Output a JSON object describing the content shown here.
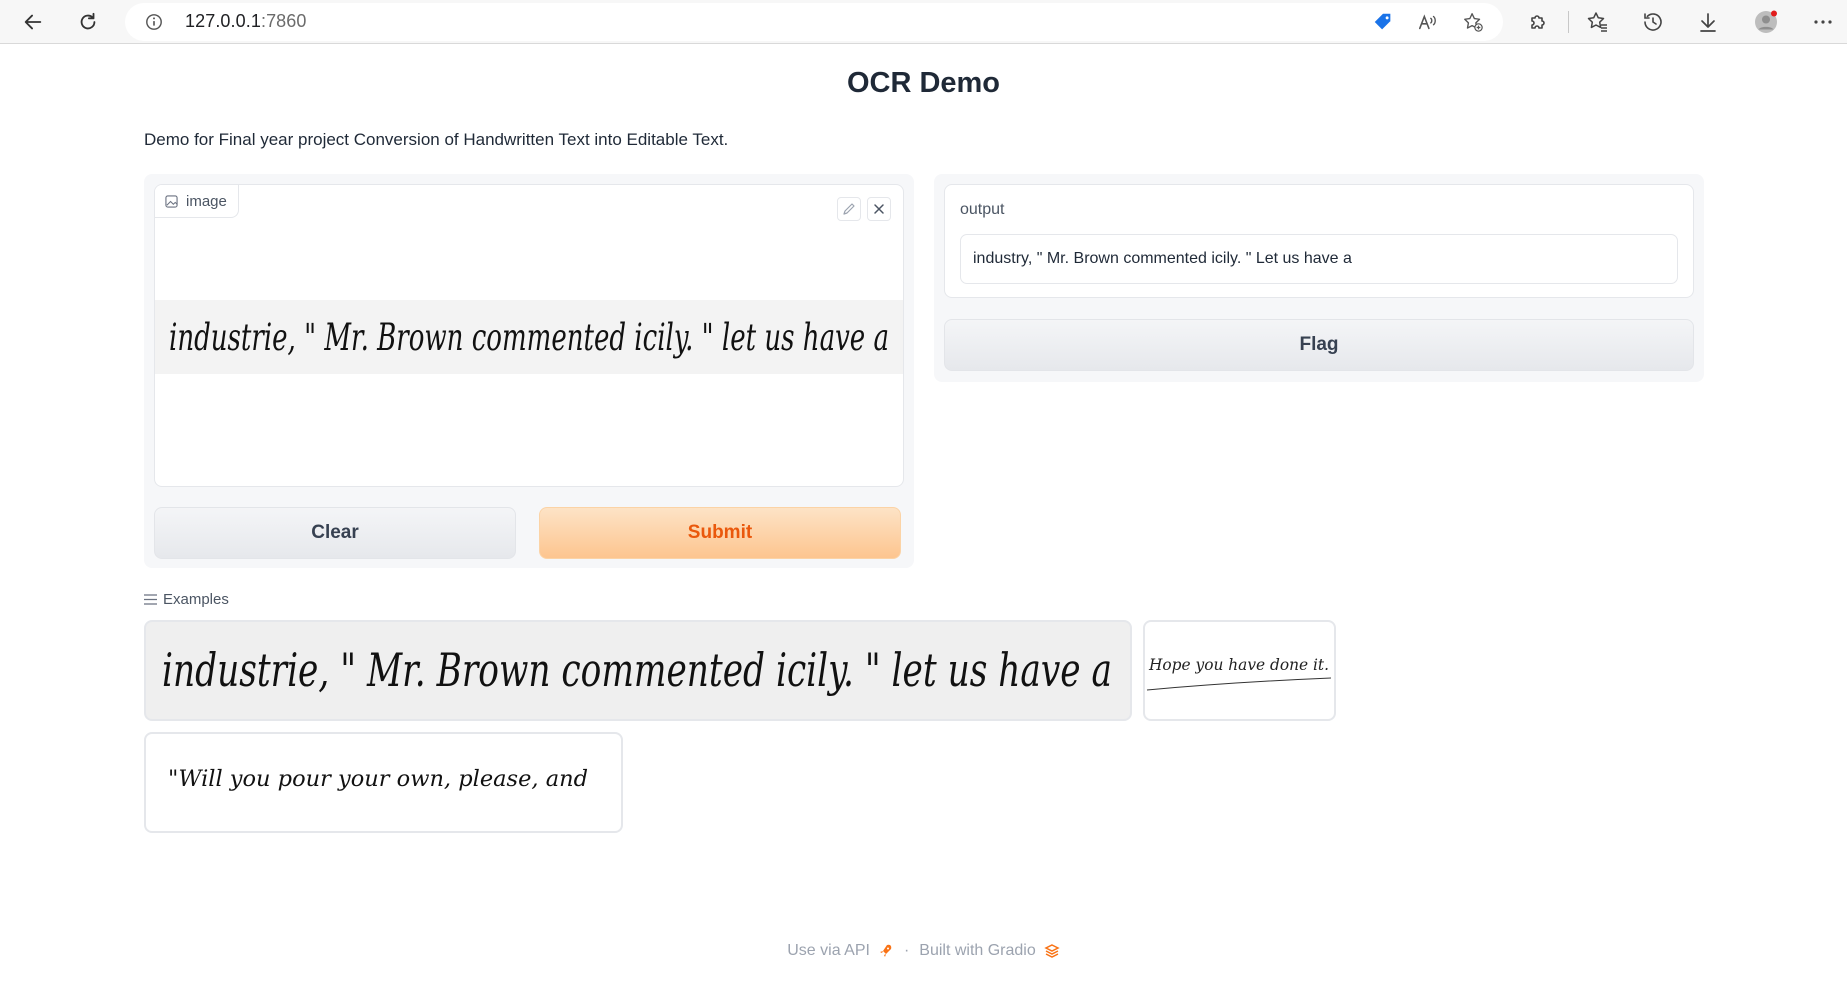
{
  "browser": {
    "url_host": "127.0.0.1",
    "url_port": ":7860"
  },
  "page": {
    "title": "OCR Demo",
    "description": "Demo for Final year project Conversion of Handwritten Text into Editable Text."
  },
  "input": {
    "label": "image",
    "handwriting": "industrie, \" Mr. Brown commented icily. \" let us have a"
  },
  "buttons": {
    "clear": "Clear",
    "submit": "Submit",
    "flag": "Flag"
  },
  "output": {
    "label": "output",
    "value": "industry, \" Mr. Brown commented icily. \" Let us have a"
  },
  "examples": {
    "label": "Examples",
    "items": [
      {
        "handwriting": "industrie, \" Mr. Brown commented icily. \" let us have a"
      },
      {
        "handwriting": "Hope you have done it."
      },
      {
        "handwriting": "\"Will you pour your own, please, and"
      }
    ]
  },
  "footer": {
    "api": "Use via API",
    "separator": "·",
    "built": "Built with Gradio"
  },
  "colors": {
    "submit_text": "#ea580c",
    "submit_bg": "#fdc58f",
    "panel_bg": "#f6f7f9",
    "gradio_logo": "#f97316"
  }
}
